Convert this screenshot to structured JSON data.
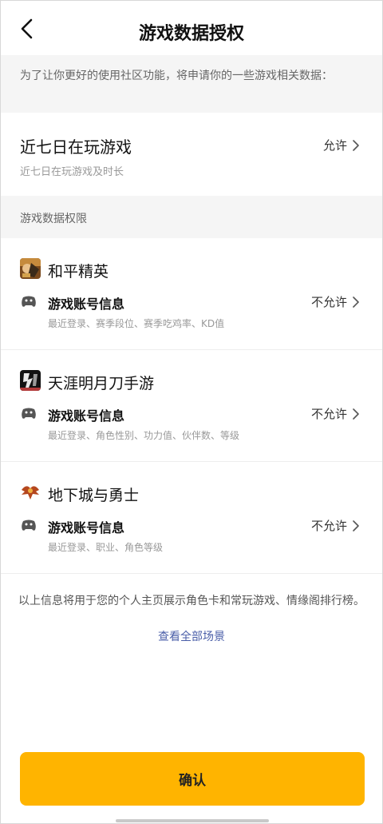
{
  "header": {
    "title": "游戏数据授权"
  },
  "notice": {
    "text": "为了让你更好的使用社区功能，将申请你的一些游戏相关数据："
  },
  "recent_games": {
    "title": "近七日在玩游戏",
    "subtitle": "近七日在玩游戏及时长",
    "status": "允许"
  },
  "section": {
    "title": "游戏数据权限"
  },
  "games": [
    {
      "name": "和平精英",
      "perm_label": "游戏账号信息",
      "perm_detail": "最近登录、赛季段位、赛季吃鸡率、KD值",
      "status": "不允许",
      "icon": "game-peace-elite-icon"
    },
    {
      "name": "天涯明月刀手游",
      "perm_label": "游戏账号信息",
      "perm_detail": "最近登录、角色性别、功力值、伙伴数、等级",
      "status": "不允许",
      "icon": "game-moonlight-blade-icon"
    },
    {
      "name": "地下城与勇士",
      "perm_label": "游戏账号信息",
      "perm_detail": "最近登录、职业、角色等级",
      "status": "不允许",
      "icon": "game-dnf-icon"
    }
  ],
  "footer": {
    "text": "以上信息将用于您的个人主页展示角色卡和常玩游戏、情缘阁排行榜。",
    "link": "查看全部场景"
  },
  "confirm_button": {
    "label": "确认"
  },
  "colors": {
    "accent": "#ffb400",
    "link": "#4a5ea8"
  }
}
